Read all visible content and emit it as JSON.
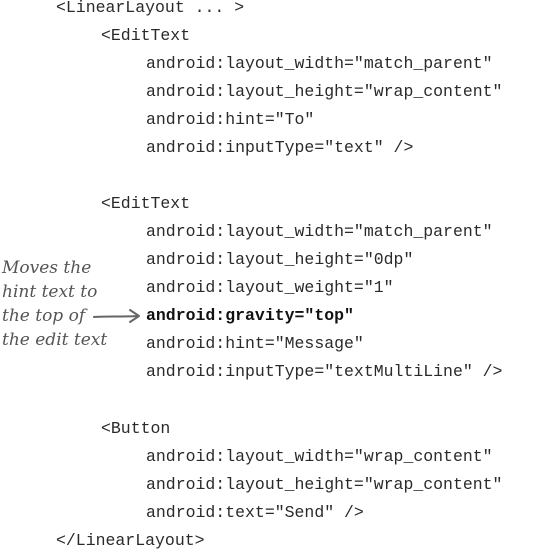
{
  "code": {
    "lines": [
      {
        "text": "<LinearLayout ... >"
      },
      {
        "text": "<EditText"
      },
      {
        "text": "android:layout_width=\"match_parent\""
      },
      {
        "text": "android:layout_height=\"wrap_content\""
      },
      {
        "text": "android:hint=\"To\""
      },
      {
        "text": "android:inputType=\"text\" />"
      },
      {
        "text": "<EditText"
      },
      {
        "text": "android:layout_width=\"match_parent\""
      },
      {
        "text": "android:layout_height=\"0dp\""
      },
      {
        "text": "android:layout_weight=\"1\""
      },
      {
        "text": "android:gravity=\"top\"",
        "bold": true
      },
      {
        "text": "android:hint=\"Message\""
      },
      {
        "text": "android:inputType=\"textMultiLine\" />"
      },
      {
        "text": "<Button"
      },
      {
        "text": "android:layout_width=\"wrap_content\""
      },
      {
        "text": "android:layout_height=\"wrap_content\""
      },
      {
        "text": "android:text=\"Send\" />"
      },
      {
        "text": "</LinearLayout>"
      }
    ]
  },
  "annotation": {
    "lines": [
      "Moves the",
      "hint text to",
      "the top of",
      "the edit text"
    ]
  }
}
